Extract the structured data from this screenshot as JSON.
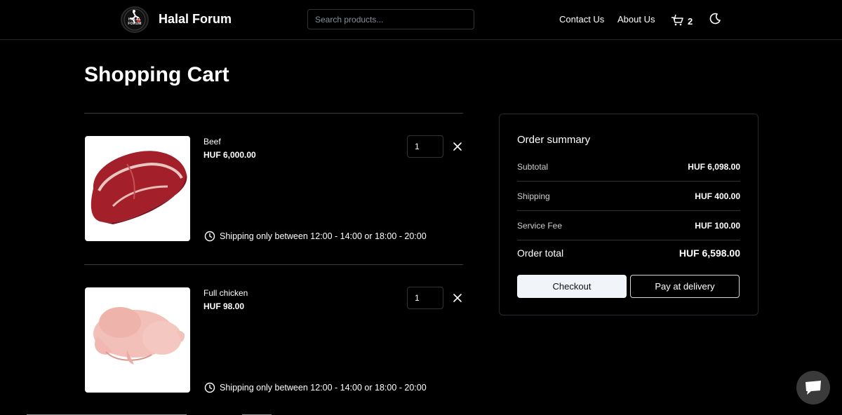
{
  "header": {
    "logo_text": "HALAL FORUM",
    "brand": "Halal Forum",
    "search_placeholder": "Search products...",
    "nav": [
      "Contact Us",
      "About Us"
    ],
    "cart_count": "2",
    "theme_icon": "moon-icon",
    "cart_icon": "cart-icon"
  },
  "page": {
    "title": "Shopping Cart"
  },
  "cart": {
    "items": [
      {
        "name": "Beef",
        "price": "HUF 6,000.00",
        "quantity": "1",
        "shipping_note": "Shipping only between 12:00 - 14:00 or 18:00 - 20:00"
      },
      {
        "name": "Full chicken",
        "price": "HUF 98.00",
        "quantity": "1",
        "shipping_note": "Shipping only between 12:00 - 14:00 or 18:00 - 20:00"
      }
    ]
  },
  "summary": {
    "title": "Order summary",
    "rows": [
      {
        "label": "Subtotal",
        "value": "HUF 6,098.00"
      },
      {
        "label": "Shipping",
        "value": "HUF 400.00"
      },
      {
        "label": "Service Fee",
        "value": "HUF 100.00"
      }
    ],
    "total_label": "Order total",
    "total_value": "HUF 6,598.00",
    "checkout_label": "Checkout",
    "pay_label": "Pay at delivery"
  },
  "colors": {
    "background": "#000000",
    "border": "#262a33",
    "checkout_bg": "#f1f5f9"
  }
}
